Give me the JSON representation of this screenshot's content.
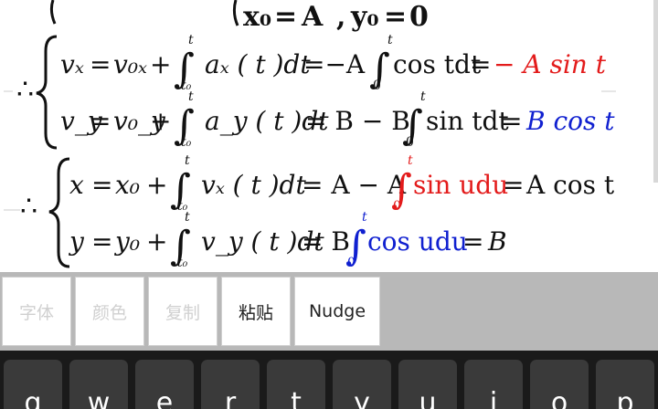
{
  "equations": {
    "eq0": {
      "x0": "x₀",
      "eq": "=",
      "A": "A",
      "comma": ",",
      "y0": "y₀",
      "zero": "0"
    },
    "therefore": "∴",
    "eq1": {
      "lhs": "vₓ",
      "eq": "=",
      "v0x": "v₀ₓ",
      "plus": "+",
      "upper": "t",
      "lower": "t₀",
      "integrand": "aₓ ( t )dt",
      "eq2": "=−A",
      "upper2": "t",
      "lower2": "0",
      "integrand2": "cos tdt",
      "eq3": "=",
      "result": "− A sin t",
      "result_color": "#e31b1b"
    },
    "eq2": {
      "lhs": "v_y",
      "eq": "=",
      "v0y": "v₀_y",
      "plus": "+",
      "upper": "t",
      "lower": "t₀",
      "integrand": "a_y ( t )dt",
      "eq2": "= B − B",
      "upper2": "t",
      "lower2": "0",
      "integrand2": "sin tdt",
      "eq3": "=",
      "result": "B cos t",
      "result_color": "#1020d0"
    },
    "eq3": {
      "lhs": "x",
      "eq": "=",
      "x0": "x₀",
      "plus": "+",
      "upper": "t",
      "lower": "t₀",
      "integrand": "vₓ ( t )dt",
      "eq2": "= A − A",
      "upper2": "t",
      "lower2": "0",
      "integrand2": "sin udu",
      "integrand2_color": "#e31b1b",
      "eq3": "=",
      "result": "A cos t"
    },
    "eq4": {
      "lhs": "y",
      "eq": "=",
      "y0": "y₀",
      "plus": "+",
      "upper": "t",
      "lower": "t₀",
      "integrand": "v_y ( t )dt",
      "eq2": "= B",
      "upper2": "t",
      "lower2": "0",
      "integrand2": "cos udu",
      "integrand2_color": "#1020d0",
      "eq3": "=",
      "result": "B"
    }
  },
  "toolbar": {
    "font_label": "字体",
    "color_label": "颜色",
    "copy_label": "复制",
    "paste_label": "粘贴",
    "nudge_label": "Nudge"
  },
  "keyboard": {
    "keys": [
      "q",
      "w",
      "e",
      "r",
      "t",
      "y",
      "u",
      "i",
      "o",
      "p"
    ]
  },
  "colors": {
    "red": "#e31b1b",
    "blue": "#1020d0",
    "toolbar_bg": "#b8b8b8",
    "keyboard_bg": "#1a1a1a"
  }
}
